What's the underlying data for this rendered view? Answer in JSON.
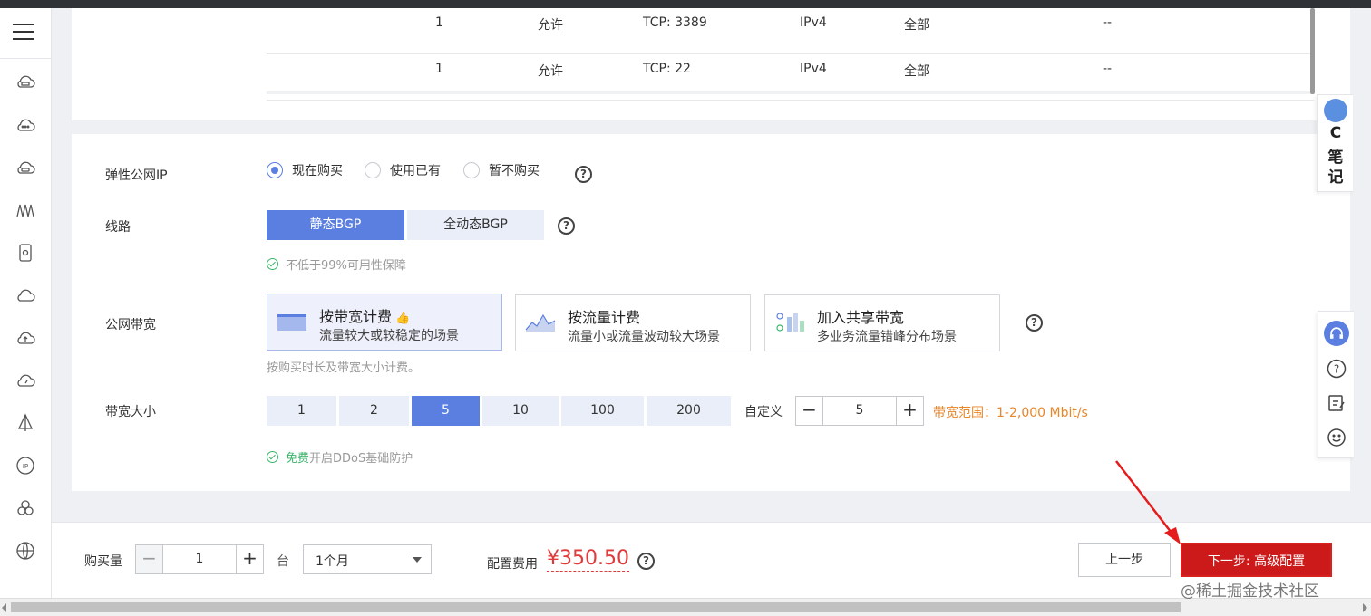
{
  "rules_table": {
    "rows": [
      {
        "priority": "1",
        "policy": "允许",
        "protocol_port": "TCP: 3389",
        "type": "IPv4",
        "source": "全部",
        "description": "--"
      },
      {
        "priority": "1",
        "policy": "允许",
        "protocol_port": "TCP: 22",
        "type": "IPv4",
        "source": "全部",
        "description": "--"
      }
    ]
  },
  "eip": {
    "label": "弹性公网IP",
    "options": [
      {
        "label": "现在购买",
        "selected": true
      },
      {
        "label": "使用已有",
        "selected": false
      },
      {
        "label": "暂不购买",
        "selected": false
      }
    ]
  },
  "line": {
    "label": "线路",
    "options": [
      {
        "label": "静态BGP",
        "selected": true
      },
      {
        "label": "全动态BGP",
        "selected": false
      }
    ],
    "note": "不低于99%可用性保障"
  },
  "bandwidth_type": {
    "label": "公网带宽",
    "cards": [
      {
        "title": "按带宽计费",
        "desc": "流量较大或较稳定的场景",
        "selected": true
      },
      {
        "title": "按流量计费",
        "desc": "流量小或流量波动较大场景",
        "selected": false
      },
      {
        "title": "加入共享带宽",
        "desc": "多业务流量错峰分布场景",
        "selected": false
      }
    ],
    "hint": "按购买时长及带宽大小计费。"
  },
  "bandwidth_size": {
    "label": "带宽大小",
    "options": [
      "1",
      "2",
      "5",
      "10",
      "100",
      "200"
    ],
    "selected": "5",
    "custom_label": "自定义",
    "custom_value": "5",
    "range_text": "带宽范围：1-2,000 Mbit/s",
    "ddos_free": "免费",
    "ddos_text": "开启DDoS基础防护"
  },
  "bottom": {
    "qty_label": "购买量",
    "qty_value": "1",
    "unit": "台",
    "duration": "1个月",
    "fee_label": "配置费用",
    "price": "¥350.50",
    "prev_button": "上一步",
    "next_button": "下一步: 高级配置"
  },
  "right_tools": {
    "note_letter": "C",
    "note_chars": [
      "笔",
      "记"
    ]
  },
  "watermark": "@稀土掘金技术社区",
  "colors": {
    "accent": "#5b7fe0",
    "danger": "#cc1a1a",
    "price": "#e03a3a",
    "ok": "#39b56a",
    "warn": "#e8862a"
  }
}
